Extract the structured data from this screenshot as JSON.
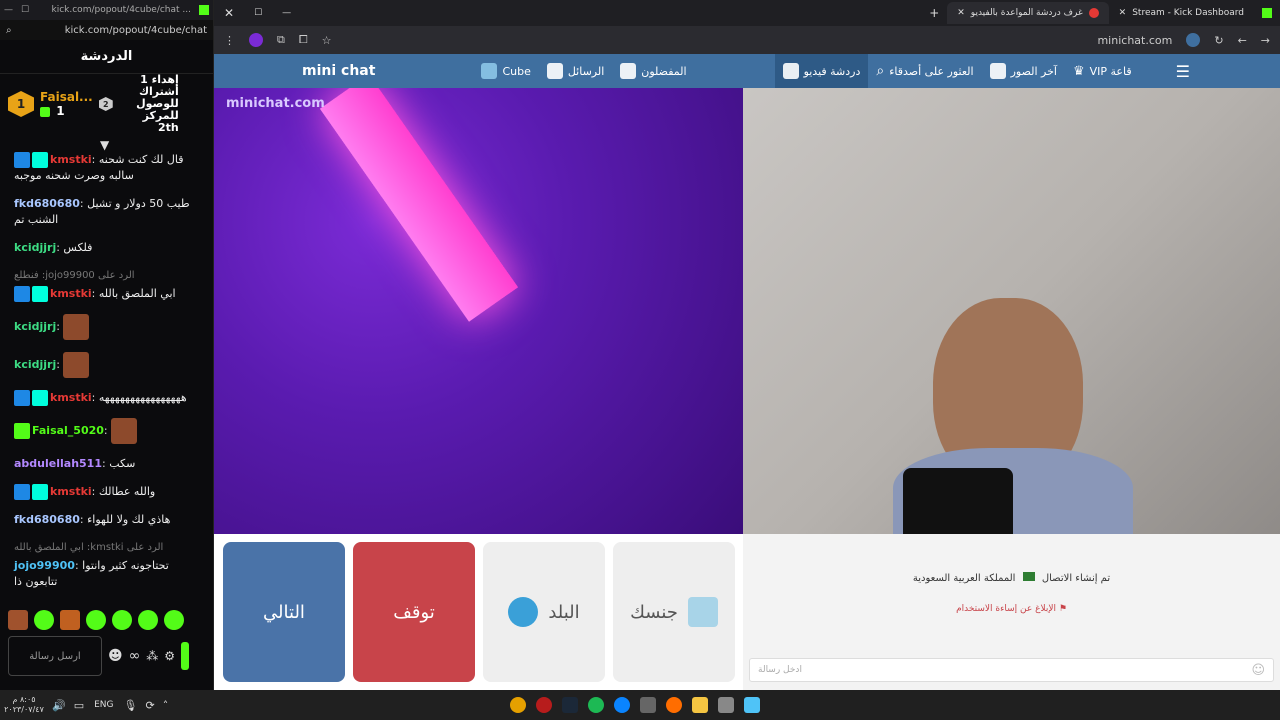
{
  "chat_window": {
    "url": "kick.com/popout/4cube/chat",
    "url_short": "kick.com/popout/4cube/chat ...",
    "title": "الدردشة",
    "top_gifter": {
      "rank": "1",
      "name": "Faisal...",
      "count": "1"
    },
    "second_rank": "2",
    "gift_text": "إهداء 1 أشتراك للوصول للمركز 2th",
    "messages": [
      {
        "user": "kmstki",
        "color": "#e53935",
        "badges": [
          "mod",
          "sub"
        ],
        "text": "قال لك كنت شحنه سالبه وصرت شحنه موجبه"
      },
      {
        "user": "fkd680680",
        "color": "#a9c7ff",
        "badges": [],
        "text": "طيب 50 دولار و تشيل الشنب تم"
      },
      {
        "user": "kcidjjrj",
        "color": "#3ddc84",
        "badges": [],
        "text": "فلكس"
      },
      {
        "reply": "الرد على jojo99900: فنطلع",
        "user": "kmstki",
        "color": "#e53935",
        "badges": [
          "mod",
          "sub"
        ],
        "text": "ابي الملصق بالله"
      },
      {
        "user": "kcidjjrj",
        "color": "#3ddc84",
        "badges": [],
        "text": "",
        "emote": true
      },
      {
        "user": "kcidjjrj",
        "color": "#3ddc84",
        "badges": [],
        "text": "",
        "emote": true
      },
      {
        "user": "kmstki",
        "color": "#e53935",
        "badges": [
          "mod",
          "sub"
        ],
        "text": "ههههههههههههههههه"
      },
      {
        "user": "Faisal_5020",
        "color": "#53fc18",
        "badges": [
          "vip"
        ],
        "text": "",
        "emote": true
      },
      {
        "user": "abdulellah511",
        "color": "#b388ff",
        "badges": [],
        "text": "سكب"
      },
      {
        "user": "kmstki",
        "color": "#e53935",
        "badges": [
          "mod",
          "sub"
        ],
        "text": "والله عطالك"
      },
      {
        "user": "fkd680680",
        "color": "#a9c7ff",
        "badges": [],
        "text": "هاذي لك ولا للهواء"
      },
      {
        "reply": "الرد على kmstki: ابي الملصق بالله",
        "user": "jojo99900",
        "color": "#4fc3f7",
        "badges": [],
        "text": "تحتاجونه كثير وانتوا تتابعون ذا"
      }
    ],
    "input_placeholder": "ارسل رسالة"
  },
  "browser": {
    "tabs": [
      {
        "label": "Stream - Kick Dashboard",
        "active": false
      },
      {
        "label": "غرف دردشة المواعدة بالفيديو",
        "active": true
      }
    ],
    "address": "minichat.com",
    "site_nav": {
      "logo": "mini chat",
      "items": [
        {
          "label": "Cube",
          "id": "cube"
        },
        {
          "label": "الرسائل",
          "id": "messages"
        },
        {
          "label": "المفضلون",
          "id": "favorites"
        },
        {
          "label": "دردشة فيديو",
          "id": "video-chat",
          "active": true
        },
        {
          "label": "العثور على أصدقاء",
          "id": "find-friends"
        },
        {
          "label": "آخر الصور",
          "id": "latest-photos"
        },
        {
          "label": "VIP قاعة",
          "id": "vip-hall"
        }
      ]
    },
    "watermark": "minichat.com",
    "controls": {
      "next": "التالي",
      "stop": "توقف",
      "country": "البلد",
      "gender": "جنسك"
    },
    "side_panel": {
      "connection_text": "تم إنشاء الاتصال",
      "country": "المملكة العربية السعودية",
      "report": "الإبلاغ عن إساءة الاستخدام",
      "message_placeholder": "ادخل رسالة"
    }
  },
  "taskbar": {
    "time": "٨:٠٥ م",
    "date": "٢٠٢٣/٠٧/٤٧",
    "lang": "ENG"
  }
}
